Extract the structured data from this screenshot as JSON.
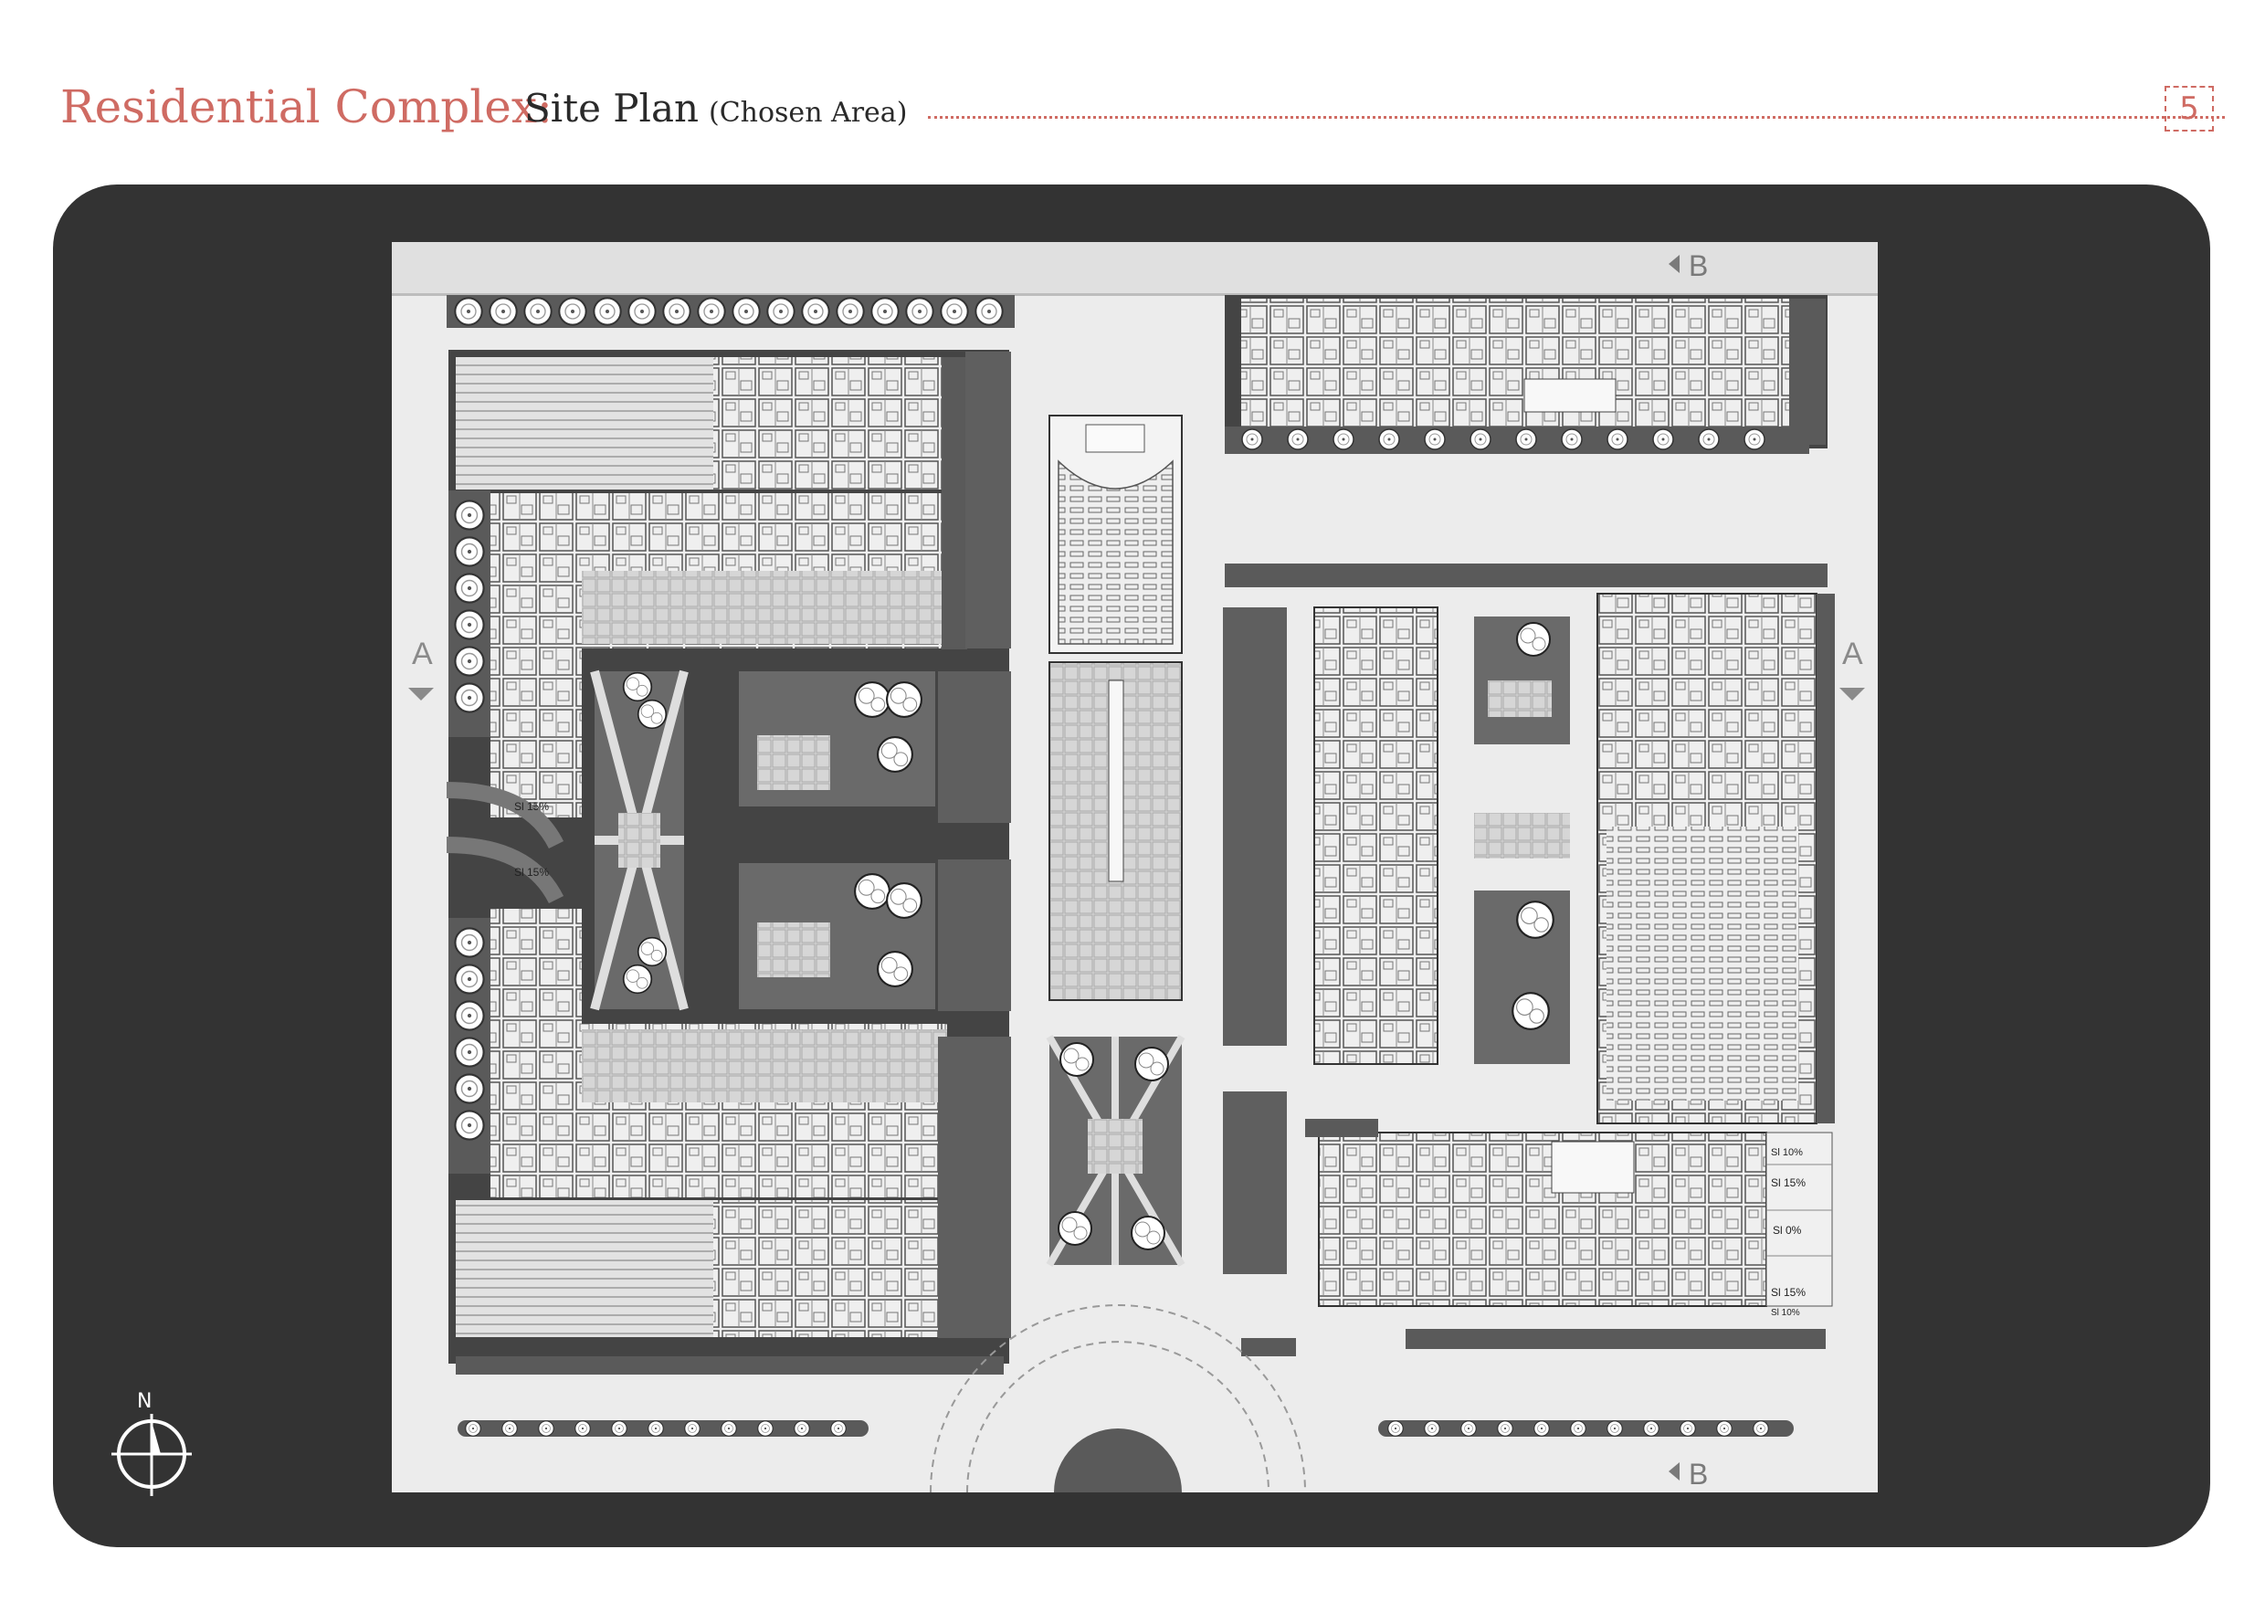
{
  "header": {
    "title": "Residential Complex:",
    "subtitle": "Site Plan",
    "note": "(Chosen Area)",
    "page_number": "5"
  },
  "plan": {
    "section_markers": {
      "a_left": "A",
      "a_right": "A",
      "b_top": "B",
      "b_bottom": "B"
    },
    "slope_labels": {
      "ramp_left_upper": "Sl 15%",
      "ramp_left_lower": "Sl 15%",
      "ramp_right_1": "Sl 10%",
      "ramp_right_2": "Sl 15%",
      "ramp_right_3": "Sl 0%",
      "ramp_right_4": "Sl 15%",
      "ramp_right_5": "Sl 10%"
    }
  },
  "compass": {
    "label": "N"
  },
  "colors": {
    "accent": "#cf6b63",
    "board": "#333333",
    "plan_bg": "#e9e9e9",
    "road": "#5a5a5a"
  }
}
